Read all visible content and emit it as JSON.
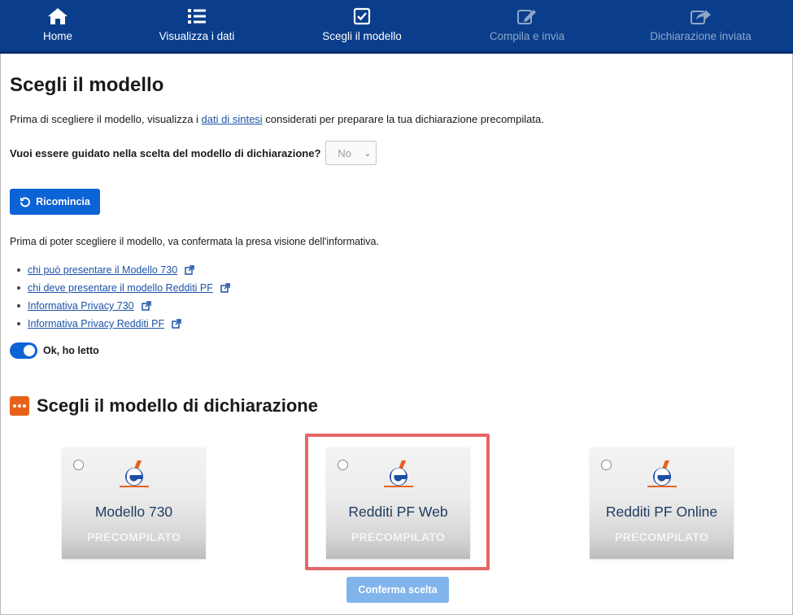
{
  "nav": {
    "items": [
      {
        "label": "Home",
        "icon": "home-icon",
        "state": "active"
      },
      {
        "label": "Visualizza i dati",
        "icon": "list-icon",
        "state": "active"
      },
      {
        "label": "Scegli il modello",
        "icon": "checkbox-icon",
        "state": "current"
      },
      {
        "label": "Compila e invia",
        "icon": "edit-icon",
        "state": "disabled"
      },
      {
        "label": "Dichiarazione inviata",
        "icon": "share-icon",
        "state": "disabled"
      }
    ]
  },
  "page": {
    "title": "Scegli il modello",
    "intro_before": "Prima di scegliere il modello, visualizza i ",
    "intro_link": "dati di sintesi",
    "intro_after": " considerati per preparare la tua dichiarazione precompilata.",
    "guide_question": "Vuoi essere guidato nella scelta del modello di dichiarazione?",
    "guide_select_value": "No",
    "restart_label": "Ricomincia",
    "info_text": "Prima di poter scegliere il modello, va confermata la presa visione dell'informativa.",
    "links": [
      "chi può presentare il Modello 730",
      "chi deve presentare il modello Redditi PF",
      "Informativa Privacy 730",
      "Informativa Privacy Redditi PF"
    ],
    "toggle_label": "Ok, ho letto",
    "toggle_on": true,
    "section_title": "Scegli il modello di dichiarazione",
    "cards": [
      {
        "title": "Modello 730",
        "subtitle": "PRECOMPILATO",
        "selected": false
      },
      {
        "title": "Redditi PF Web",
        "subtitle": "PRECOMPILATO",
        "selected": false
      },
      {
        "title": "Redditi PF Online",
        "subtitle": "PRECOMPILATO",
        "selected": false
      }
    ],
    "confirm_label": "Conferma scelta"
  },
  "colors": {
    "nav_bg": "#0a3e8c",
    "primary": "#0c63d6",
    "confirm_disabled": "#82b4ec",
    "highlight": "#e66767",
    "section_icon": "#e8611a",
    "link": "#1b53a8"
  }
}
